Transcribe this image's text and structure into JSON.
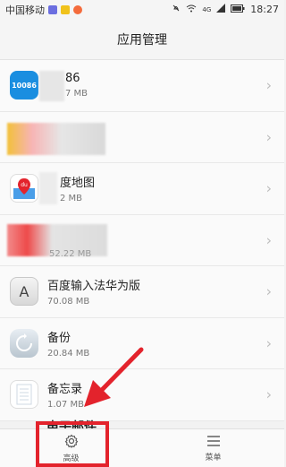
{
  "status_bar": {
    "carrier": "中国移动",
    "network": "4G",
    "time": "18:27"
  },
  "header": {
    "title": "应用管理"
  },
  "apps": [
    {
      "name": "86",
      "size": "7 MB",
      "icon": "10086-icon"
    },
    {
      "name": "",
      "size": "",
      "icon": "blurred-app-icon"
    },
    {
      "name": "度地图",
      "size": "2 MB",
      "icon": "baidu-map-icon"
    },
    {
      "name": "",
      "size": "52.22 MB",
      "icon": "blurred-app-icon"
    },
    {
      "name": "百度输入法华为版",
      "size": "70.08 MB",
      "icon": "keyboard-a-icon"
    },
    {
      "name": "备份",
      "size": "20.84 MB",
      "icon": "backup-icon"
    },
    {
      "name": "备忘录",
      "size": "1.07 MB",
      "icon": "notes-icon"
    }
  ],
  "partial_row": {
    "name": "电子邮件"
  },
  "bottom_nav": {
    "left_label": "高级",
    "right_label": "菜单"
  },
  "colors": {
    "highlight": "#e3232c",
    "chevron": "#bdbdbd"
  }
}
